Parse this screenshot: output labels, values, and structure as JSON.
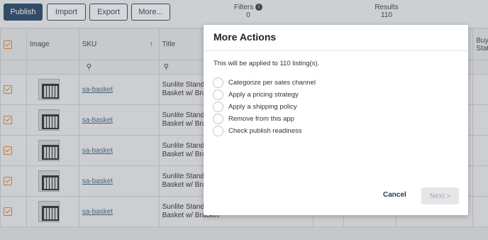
{
  "toolbar": {
    "publish": "Publish",
    "import": "Import",
    "export": "Export",
    "more": "More...",
    "filters_label": "Filters",
    "filters_count": "0",
    "results_label": "Results",
    "results_count": "110"
  },
  "table": {
    "headers": {
      "image": "Image",
      "sku": "SKU",
      "title": "Title",
      "buy": "Buy (",
      "status": "Statu"
    },
    "rows": [
      {
        "sku": "sa-basket",
        "title_line1": "Sunlite Standard",
        "title_line2": "Basket w/ Bracke"
      },
      {
        "sku": "sa-basket",
        "title_line1": "Sunlite Standard",
        "title_line2": "Basket w/ Bracke"
      },
      {
        "sku": "sa-basket",
        "title_line1": "Sunlite Standard",
        "title_line2": "Basket w/ Bracke"
      },
      {
        "sku": "sa-basket",
        "title_line1": "Sunlite Standard",
        "title_line2": "Basket w/ Bracke"
      },
      {
        "sku": "sa-basket",
        "title_line1": "Sunlite Standard",
        "title_line2": "Basket w/ Bracket"
      }
    ]
  },
  "modal": {
    "title": "More Actions",
    "note": "This will be applied to 110 listing(s).",
    "options": [
      "Categorize per sales channel",
      "Apply a pricing strategy",
      "Apply a shipping policy",
      "Remove from this app",
      "Check publish readiness"
    ],
    "cancel": "Cancel",
    "next": "Next >"
  }
}
